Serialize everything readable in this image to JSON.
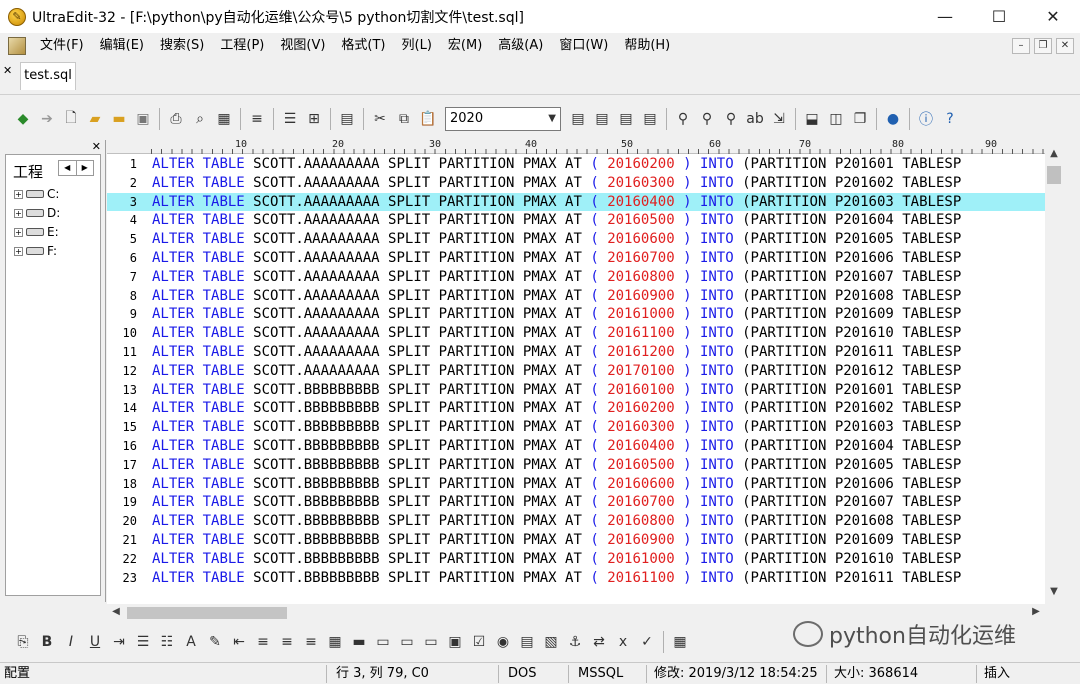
{
  "window": {
    "title": "UltraEdit-32 - [F:\\python\\py自动化运维\\公众号\\5 python切割文件\\test.sql]"
  },
  "menu": [
    "文件(F)",
    "编辑(E)",
    "搜索(S)",
    "工程(P)",
    "视图(V)",
    "格式(T)",
    "列(L)",
    "宏(M)",
    "高级(A)",
    "窗口(W)",
    "帮助(H)"
  ],
  "tab": {
    "label": "test.sql"
  },
  "toolbar": {
    "combo_value": "2020"
  },
  "project": {
    "title": "工程",
    "drives": [
      "C:",
      "D:",
      "E:",
      "F:"
    ]
  },
  "ruler": {
    "labels": [
      "10",
      "20",
      "30",
      "40",
      "50",
      "60",
      "70",
      "80",
      "90"
    ]
  },
  "editor": {
    "highlighted_line": 3,
    "lines": [
      {
        "n": "1",
        "table": "SCOTT.AAAAAAAAA",
        "val": "20160200",
        "part": "P201601"
      },
      {
        "n": "2",
        "table": "SCOTT.AAAAAAAAA",
        "val": "20160300",
        "part": "P201602"
      },
      {
        "n": "3",
        "table": "SCOTT.AAAAAAAAA",
        "val": "20160400",
        "part": "P201603"
      },
      {
        "n": "4",
        "table": "SCOTT.AAAAAAAAA",
        "val": "20160500",
        "part": "P201604"
      },
      {
        "n": "5",
        "table": "SCOTT.AAAAAAAAA",
        "val": "20160600",
        "part": "P201605"
      },
      {
        "n": "6",
        "table": "SCOTT.AAAAAAAAA",
        "val": "20160700",
        "part": "P201606"
      },
      {
        "n": "7",
        "table": "SCOTT.AAAAAAAAA",
        "val": "20160800",
        "part": "P201607"
      },
      {
        "n": "8",
        "table": "SCOTT.AAAAAAAAA",
        "val": "20160900",
        "part": "P201608"
      },
      {
        "n": "9",
        "table": "SCOTT.AAAAAAAAA",
        "val": "20161000",
        "part": "P201609"
      },
      {
        "n": "10",
        "table": "SCOTT.AAAAAAAAA",
        "val": "20161100",
        "part": "P201610"
      },
      {
        "n": "11",
        "table": "SCOTT.AAAAAAAAA",
        "val": "20161200",
        "part": "P201611"
      },
      {
        "n": "12",
        "table": "SCOTT.AAAAAAAAA",
        "val": "20170100",
        "part": "P201612"
      },
      {
        "n": "13",
        "table": "SCOTT.BBBBBBBBB",
        "val": "20160100",
        "part": "P201601"
      },
      {
        "n": "14",
        "table": "SCOTT.BBBBBBBBB",
        "val": "20160200",
        "part": "P201602"
      },
      {
        "n": "15",
        "table": "SCOTT.BBBBBBBBB",
        "val": "20160300",
        "part": "P201603"
      },
      {
        "n": "16",
        "table": "SCOTT.BBBBBBBBB",
        "val": "20160400",
        "part": "P201604"
      },
      {
        "n": "17",
        "table": "SCOTT.BBBBBBBBB",
        "val": "20160500",
        "part": "P201605"
      },
      {
        "n": "18",
        "table": "SCOTT.BBBBBBBBB",
        "val": "20160600",
        "part": "P201606"
      },
      {
        "n": "19",
        "table": "SCOTT.BBBBBBBBB",
        "val": "20160700",
        "part": "P201607"
      },
      {
        "n": "20",
        "table": "SCOTT.BBBBBBBBB",
        "val": "20160800",
        "part": "P201608"
      },
      {
        "n": "21",
        "table": "SCOTT.BBBBBBBBB",
        "val": "20160900",
        "part": "P201609"
      },
      {
        "n": "22",
        "table": "SCOTT.BBBBBBBBB",
        "val": "20161000",
        "part": "P201610"
      },
      {
        "n": "23",
        "table": "SCOTT.BBBBBBBBB",
        "val": "20161100",
        "part": "P201611"
      }
    ],
    "tokens": {
      "alter": "ALTER",
      "table_kw": "TABLE",
      "split": "SPLIT PARTITION PMAX AT",
      "open": "(",
      "close": ")",
      "into": "INTO",
      "partition": "(PARTITION",
      "tail": "TABLESP"
    }
  },
  "watermark": {
    "text": "python自动化运维"
  },
  "status": {
    "left": "配置",
    "position": "行 3, 列 79, C0",
    "eol": "DOS",
    "syntax": "MSSQL",
    "modified": "修改: 2019/3/12 18:54:25",
    "size": "大小: 368614",
    "mode": "插入"
  },
  "colors": {
    "keyword": "#1a1ae8",
    "number": "#e02020",
    "highlight": "#9ff0f8"
  }
}
